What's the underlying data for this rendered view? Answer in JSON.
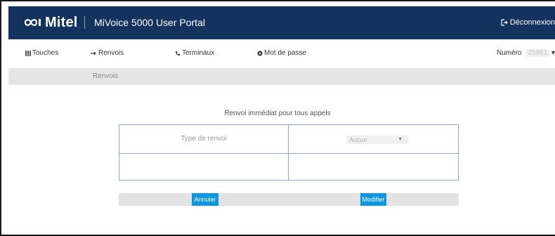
{
  "header": {
    "brand": "Mitel",
    "app_title": "MiVoice 5000 User Portal",
    "logout_label": "Déconnexion",
    "bg_color": "#14325e"
  },
  "nav": {
    "items": [
      {
        "label": "Touches",
        "icon": "grid-icon"
      },
      {
        "label": "Renvois",
        "icon": "arrow-right-icon"
      },
      {
        "label": "Terminaux",
        "icon": "phone-icon"
      },
      {
        "label": "Mot de passe",
        "icon": "gear-icon"
      }
    ],
    "numero_label": "Numéro",
    "numero_value": "25981"
  },
  "breadcrumb": "Renvois",
  "form": {
    "title": "Renvoi immédiat pour tous appels",
    "row1_label": "Type de renvoi",
    "select_value": "Aucun",
    "cancel_label": "Annuler",
    "modify_label": "Modifier",
    "accent_color": "#0c97e0"
  }
}
